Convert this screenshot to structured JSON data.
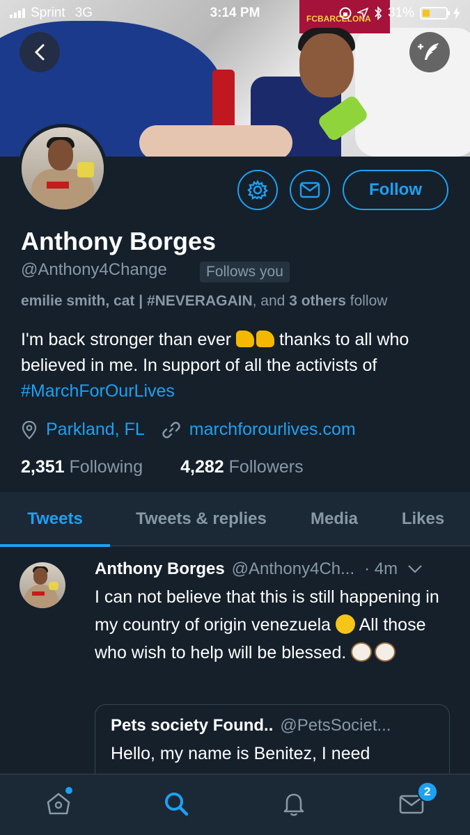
{
  "status_bar": {
    "carrier": "Sprint",
    "network": "3G",
    "time": "3:14 PM",
    "battery": "31%"
  },
  "profile": {
    "display_name": "Anthony Borges",
    "handle": "@Anthony4Change",
    "follows_you": "Follows you",
    "follow_button": "Follow",
    "known_followers": {
      "names": "emilie smith, cat | #NEVERAGAIN",
      "joiner": ", and",
      "others": "3 others",
      "suffix": "follow"
    },
    "bio": {
      "part1": "I'm back stronger than ever",
      "part2": "thanks to all who believed in me. In support of all the activists of",
      "hashtag": "#MarchForOurLives"
    },
    "location": "Parkland, FL",
    "website": "marchforourlives.com",
    "following_count": "2,351",
    "following_label": "Following",
    "followers_count": "4,282",
    "followers_label": "Followers"
  },
  "tabs": [
    {
      "label": "Tweets",
      "active": true
    },
    {
      "label": "Tweets & replies",
      "active": false
    },
    {
      "label": "Media",
      "active": false
    },
    {
      "label": "Likes",
      "active": false
    }
  ],
  "tweet": {
    "name": "Anthony Borges",
    "handle": "@Anthony4Ch...",
    "time": "· 4m",
    "text_part1": "I can not believe that this is still happening in my country of origin venezuela",
    "text_part2": "All those who wish to help will be blessed.",
    "quote": {
      "name": "Pets society Found..",
      "handle": "@PetsSociet...",
      "text": "Hello, my name is Benitez, I need"
    }
  },
  "bottom_nav": {
    "messages_badge": "2"
  },
  "colors": {
    "background": "#15202b",
    "accent": "#1da1f2",
    "secondary_text": "#8899a6"
  }
}
